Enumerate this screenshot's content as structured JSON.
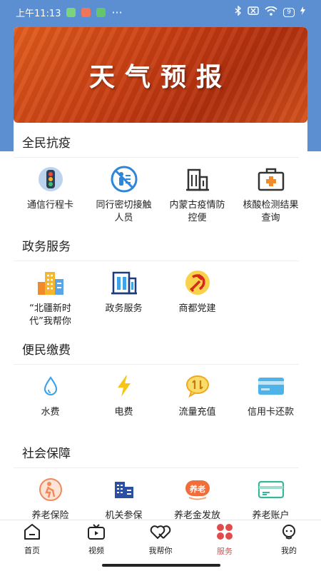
{
  "status": {
    "time": "上午11:13",
    "dots": "···",
    "battery": "9",
    "notif_colors": [
      "#7bd37b",
      "#f0765a",
      "#63c66b"
    ]
  },
  "banner": {
    "title": "天气预报"
  },
  "sections": [
    {
      "title": "全民抗疫",
      "items": [
        {
          "label": "通信行程卡",
          "icon": "traffic-light-icon"
        },
        {
          "label": "同行密切接触人员",
          "icon": "no-contact-icon"
        },
        {
          "label": "内蒙古疫情防控便",
          "icon": "building-icon"
        },
        {
          "label": "核酸检测结果查询",
          "icon": "medical-kit-icon"
        }
      ]
    },
    {
      "title": "政务服务",
      "items": [
        {
          "label": "“北疆新时代”我帮你",
          "icon": "city-icon"
        },
        {
          "label": "政务服务",
          "icon": "government-building-icon"
        },
        {
          "label": "商都党建",
          "icon": "party-emblem-icon"
        }
      ]
    },
    {
      "title": "便民缴费",
      "items": [
        {
          "label": "水费",
          "icon": "water-drop-icon"
        },
        {
          "label": "电费",
          "icon": "lightning-icon"
        },
        {
          "label": "流量充值",
          "icon": "data-recharge-icon"
        },
        {
          "label": "信用卡还款",
          "icon": "credit-card-icon"
        }
      ]
    },
    {
      "title": "社会保障",
      "items": [
        {
          "label": "养老保险",
          "icon": "elderly-icon"
        },
        {
          "label": "机关参保",
          "icon": "office-icon"
        },
        {
          "label": "养老金发放",
          "icon": "pension-badge-icon"
        },
        {
          "label": "养老账户",
          "icon": "account-card-icon"
        }
      ]
    }
  ],
  "pension_badge_text": "养老",
  "tabs": [
    {
      "label": "首页",
      "icon": "home-icon",
      "active": false
    },
    {
      "label": "视频",
      "icon": "tv-icon",
      "active": false
    },
    {
      "label": "我帮你",
      "icon": "hearts-icon",
      "active": false
    },
    {
      "label": "服务",
      "icon": "clover-icon",
      "active": true
    },
    {
      "label": "我的",
      "icon": "user-icon",
      "active": false
    }
  ],
  "colors": {
    "header_blue": "#5b8fd2",
    "banner_orange": "#d24a18",
    "active_tab": "#e24b4b"
  }
}
